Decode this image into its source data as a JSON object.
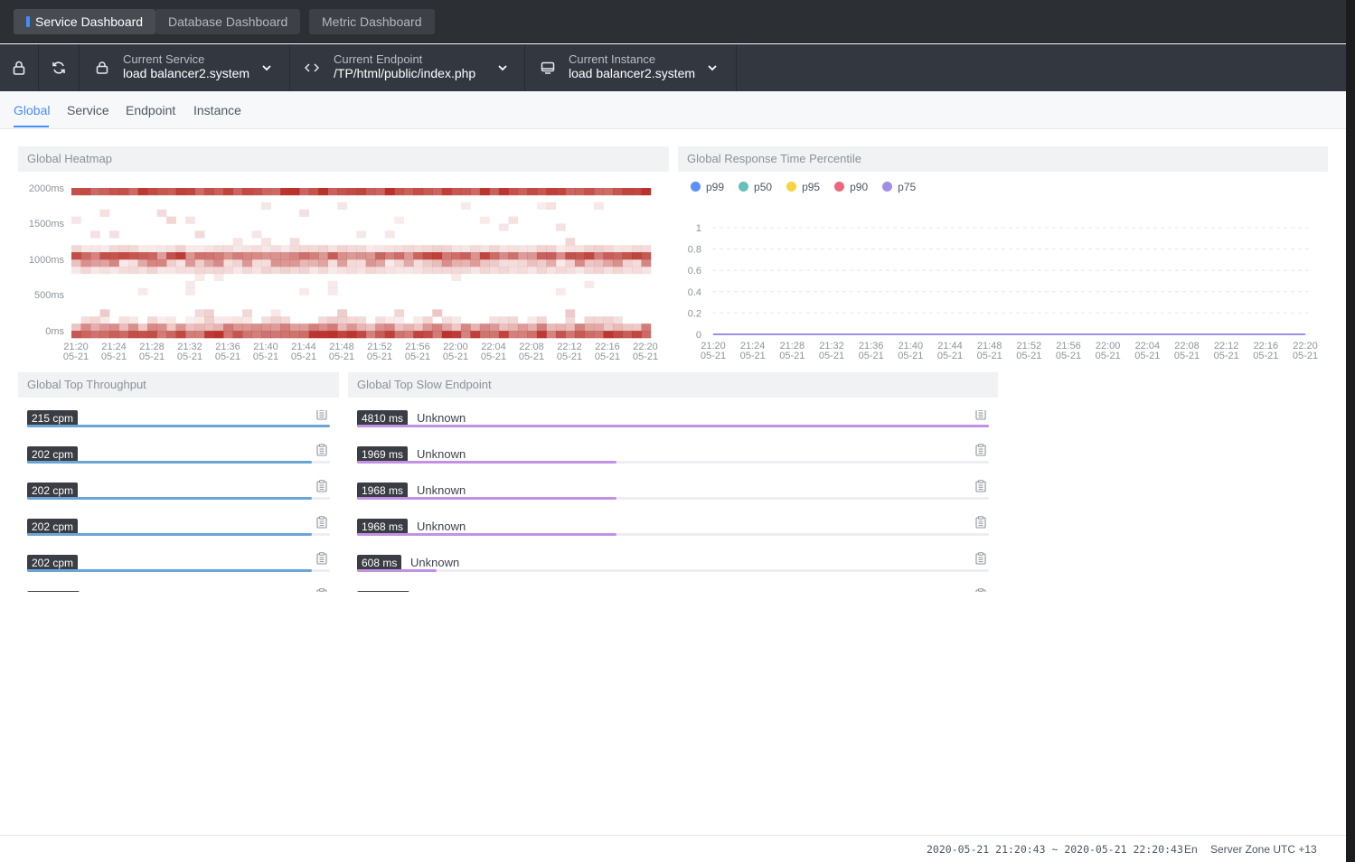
{
  "top_tabs": [
    "Service Dashboard",
    "Database Dashboard",
    "Metric Dashboard"
  ],
  "toolbar": {
    "lock_icon": "lock-icon",
    "refresh_icon": "refresh-icon",
    "service": {
      "label": "Current Service",
      "value": "load balancer2.system"
    },
    "endpoint": {
      "label": "Current Endpoint",
      "value": "/TP/html/public/index.php"
    },
    "instance": {
      "label": "Current Instance",
      "value": "load balancer2.system"
    }
  },
  "subnav": [
    "Global",
    "Service",
    "Endpoint",
    "Instance"
  ],
  "panels": {
    "heatmap": "Global Heatmap",
    "percentile": "Global Response Time Percentile",
    "throughput": "Global Top Throughput",
    "slow": "Global Top Slow Endpoint"
  },
  "chart_data": [
    {
      "type": "heatmap",
      "title": "Global Heatmap",
      "y_ticks": [
        "2000ms",
        "1500ms",
        "1000ms",
        "500ms",
        "0ms"
      ],
      "x_ticks": [
        "21:20",
        "21:24",
        "21:28",
        "21:32",
        "21:36",
        "21:40",
        "21:44",
        "21:48",
        "21:52",
        "21:56",
        "22:00",
        "22:04",
        "22:08",
        "22:12",
        "22:16",
        "22:20"
      ],
      "x_date": "05-21",
      "color": "#b8312a",
      "high_rows": [
        "2000ms",
        "1100ms",
        "0ms"
      ]
    },
    {
      "type": "line",
      "title": "Global Response Time Percentile",
      "x": [
        "21:20",
        "21:24",
        "21:28",
        "21:32",
        "21:36",
        "21:40",
        "21:44",
        "21:48",
        "21:52",
        "21:56",
        "22:00",
        "22:04",
        "22:08",
        "22:12",
        "22:16",
        "22:20"
      ],
      "x_date": "05-21",
      "y_ticks": [
        "1",
        "0.8",
        "0.6",
        "0.4",
        "0.2",
        "0"
      ],
      "ylim": [
        0,
        1
      ],
      "grid": true,
      "legend": "top-left",
      "series": [
        {
          "name": "p99",
          "color": "#5b8ff9",
          "values": [
            0,
            0,
            0,
            0,
            0,
            0,
            0,
            0,
            0,
            0,
            0,
            0,
            0,
            0,
            0,
            0
          ]
        },
        {
          "name": "p50",
          "color": "#66bfbf",
          "values": [
            0,
            0,
            0,
            0,
            0,
            0,
            0,
            0,
            0,
            0,
            0,
            0,
            0,
            0,
            0,
            0
          ]
        },
        {
          "name": "p95",
          "color": "#f5d445",
          "values": [
            0,
            0,
            0,
            0,
            0,
            0,
            0,
            0,
            0,
            0,
            0,
            0,
            0,
            0,
            0,
            0
          ]
        },
        {
          "name": "p90",
          "color": "#e8697a",
          "values": [
            0,
            0,
            0,
            0,
            0,
            0,
            0,
            0,
            0,
            0,
            0,
            0,
            0,
            0,
            0,
            0
          ]
        },
        {
          "name": "p75",
          "color": "#a18ee5",
          "values": [
            0,
            0,
            0,
            0,
            0,
            0,
            0,
            0,
            0,
            0,
            0,
            0,
            0,
            0,
            0,
            0
          ]
        }
      ]
    }
  ],
  "throughput": {
    "color": "#6aa5d6",
    "items": [
      {
        "value": "215 cpm",
        "ratio": 1.0
      },
      {
        "value": "202 cpm",
        "ratio": 0.94
      },
      {
        "value": "202 cpm",
        "ratio": 0.94
      },
      {
        "value": "202 cpm",
        "ratio": 0.94
      },
      {
        "value": "202 cpm",
        "ratio": 0.94
      }
    ]
  },
  "slow_endpoints": {
    "color": "#c391e4",
    "items": [
      {
        "value": "4810 ms",
        "name": "Unknown",
        "ratio": 1.0
      },
      {
        "value": "1969 ms",
        "name": "Unknown",
        "ratio": 0.41
      },
      {
        "value": "1968 ms",
        "name": "Unknown",
        "ratio": 0.41
      },
      {
        "value": "1968 ms",
        "name": "Unknown",
        "ratio": 0.41
      },
      {
        "value": "608 ms",
        "name": "Unknown",
        "ratio": 0.126
      }
    ]
  },
  "footer": {
    "range": "2020-05-21 21:20:43 ~ 2020-05-21 22:20:43",
    "lang": "En",
    "zone": "Server Zone UTC +13"
  }
}
